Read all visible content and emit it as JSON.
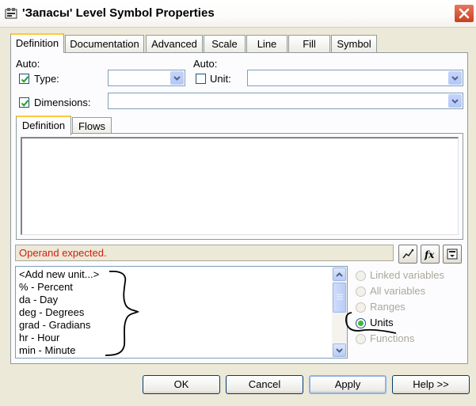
{
  "window": {
    "title": "'Запасы' Level Symbol Properties"
  },
  "tabs": [
    {
      "label": "Definition",
      "active": true
    },
    {
      "label": "Documentation",
      "active": false
    },
    {
      "label": "Advanced",
      "active": false
    },
    {
      "label": "Scale",
      "active": false
    },
    {
      "label": "Line",
      "active": false
    },
    {
      "label": "Fill",
      "active": false
    },
    {
      "label": "Symbol",
      "active": false
    }
  ],
  "definition": {
    "auto_label": "Auto:",
    "type": {
      "label": "Type:",
      "checked": true,
      "value": ""
    },
    "unit_auto_label": "Auto:",
    "unit": {
      "label": "Unit:",
      "checked": false,
      "value": ""
    },
    "dimensions": {
      "label": "Dimensions:",
      "checked": true,
      "value": ""
    },
    "inner_tabs": [
      {
        "label": "Definition",
        "active": true
      },
      {
        "label": "Flows",
        "active": false
      }
    ],
    "equation_text": "",
    "status_message": "Operand expected.",
    "tool_icons": [
      "graph-icon",
      "function-icon",
      "insert-icon"
    ],
    "list_items": [
      "<Add new unit...>",
      "% - Percent",
      "da - Day",
      "deg - Degrees",
      "grad - Gradians",
      "hr - Hour",
      "min - Minute"
    ],
    "radio_options": [
      {
        "label": "Linked variables",
        "selected": false,
        "enabled": false
      },
      {
        "label": "All variables",
        "selected": false,
        "enabled": false
      },
      {
        "label": "Ranges",
        "selected": false,
        "enabled": false
      },
      {
        "label": "Units",
        "selected": true,
        "enabled": true
      },
      {
        "label": "Functions",
        "selected": false,
        "enabled": false
      }
    ]
  },
  "buttons": {
    "ok": "OK",
    "cancel": "Cancel",
    "apply": "Apply",
    "help": "Help >>"
  },
  "colors": {
    "window_bg": "#ece9d8",
    "status_text": "#d02010",
    "tab_highlight": "#ffc83c",
    "radio_dot": "#3fb93a",
    "close_button": "#c7411f"
  }
}
